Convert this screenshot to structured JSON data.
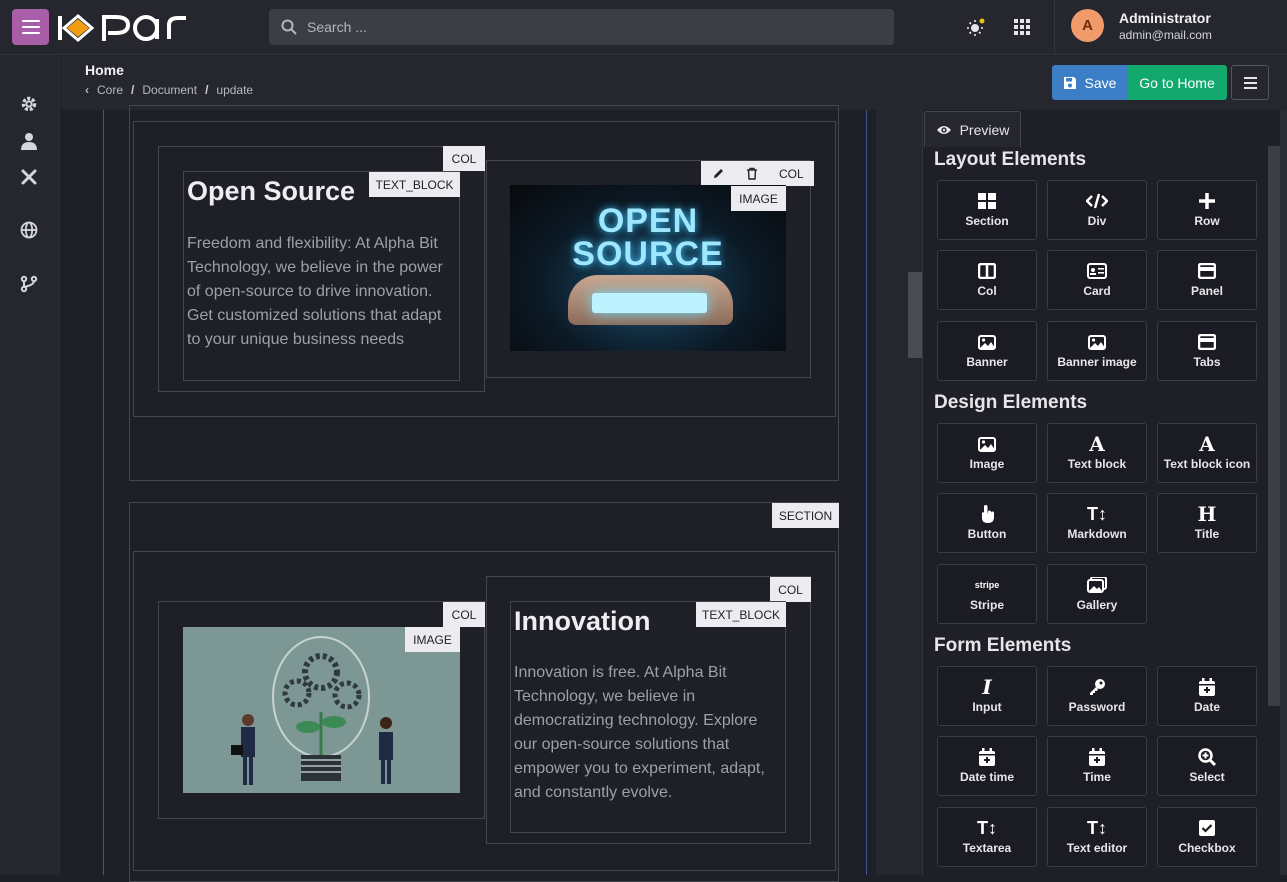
{
  "app": {
    "logo_text": "1opar",
    "search_placeholder": "Search ...",
    "user": {
      "initial": "A",
      "name": "Administrator",
      "email": "admin@mail.com"
    }
  },
  "sidebar": {
    "items": [
      {
        "icon": "gear-icon"
      },
      {
        "icon": "user-icon"
      },
      {
        "icon": "tools-icon"
      },
      {
        "icon": "globe-icon"
      },
      {
        "icon": "branch-icon"
      }
    ]
  },
  "header": {
    "title": "Home",
    "breadcrumb": [
      "Core",
      "Document",
      "update"
    ],
    "save_label": "Save",
    "home_label": "Go to Home"
  },
  "canvas": {
    "block1": {
      "col_tag": "COL",
      "text_tag": "TEXT_BLOCK",
      "heading": "Open Source",
      "text": "Freedom and flexibility: At Alpha Bit Technology, we believe in the power of open-source to drive innovation. Get customized solutions that adapt to your unique business needs",
      "col2_tag": "COL",
      "image_tag": "IMAGE",
      "image_text_1": "OPEN",
      "image_text_2": "SOURCE"
    },
    "section_tag": "SECTION",
    "block2": {
      "col_tag": "COL",
      "image_tag": "IMAGE",
      "col2_tag": "COL",
      "text_tag": "TEXT_BLOCK",
      "heading": "Innovation",
      "text": "Innovation is free. At Alpha Bit Technology, we believe in democratizing technology. Explore our open-source solutions that empower you to experiment, adapt, and constantly evolve."
    }
  },
  "panel": {
    "preview_label": "Preview",
    "layout_title": "Layout Elements",
    "layout": [
      "Section",
      "Div",
      "Row",
      "Col",
      "Card",
      "Panel",
      "Banner",
      "Banner image",
      "Tabs"
    ],
    "design_title": "Design Elements",
    "design": [
      "Image",
      "Text block",
      "Text block icon",
      "Button",
      "Markdown",
      "Title",
      "Stripe",
      "Gallery"
    ],
    "stripe_icon_text": "stripe",
    "form_title": "Form Elements",
    "form": [
      "Input",
      "Password",
      "Date",
      "Date time",
      "Time",
      "Select",
      "Textarea",
      "Text editor",
      "Checkbox"
    ]
  }
}
